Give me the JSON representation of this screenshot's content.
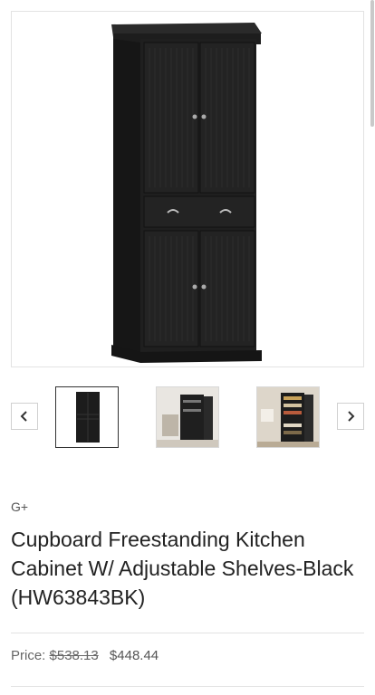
{
  "product": {
    "brand": "G+",
    "title": "Cupboard Freestanding Kitchen Cabinet W/ Adjustable Shelves-Black (HW63843BK)",
    "price_label": "Price:",
    "original_price": "$538.13",
    "sale_price": "$448.44"
  },
  "gallery": {
    "prev_icon": "chevron-left-icon",
    "next_icon": "chevron-right-icon",
    "thumbnails": [
      {
        "name": "thumbnail-front",
        "active": true
      },
      {
        "name": "thumbnail-room-open",
        "active": false
      },
      {
        "name": "thumbnail-room-filled",
        "active": false
      }
    ]
  },
  "colors": {
    "cabinet": "#1e1e1e",
    "border": "#d8d8d8",
    "text": "#222222"
  }
}
